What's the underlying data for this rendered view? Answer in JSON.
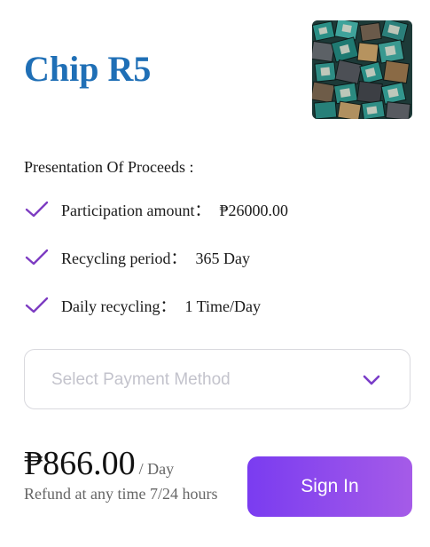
{
  "product": {
    "title": "Chip R5",
    "image_icon": "circuit-chips-photo"
  },
  "proceeds": {
    "heading": "Presentation Of Proceeds :",
    "items": [
      {
        "label": "Participation amount：",
        "value": "₱26000.00",
        "icon": "check-icon"
      },
      {
        "label": "Recycling period：",
        "value": "365 Day",
        "icon": "check-icon"
      },
      {
        "label": "Daily recycling：",
        "value": "1 Time/Day",
        "icon": "check-icon"
      }
    ]
  },
  "payment": {
    "placeholder": "Select Payment Method",
    "icon": "chevron-down-icon"
  },
  "price": {
    "amount": "₱866.00",
    "unit": "/ Day",
    "refund_note": "Refund at any time 7/24 hours"
  },
  "actions": {
    "signin_label": "Sign In"
  },
  "colors": {
    "title": "#1f6fb6",
    "accent": "#7a3cf0",
    "accent_end": "#a55be8",
    "check": "#7d3cc2"
  }
}
